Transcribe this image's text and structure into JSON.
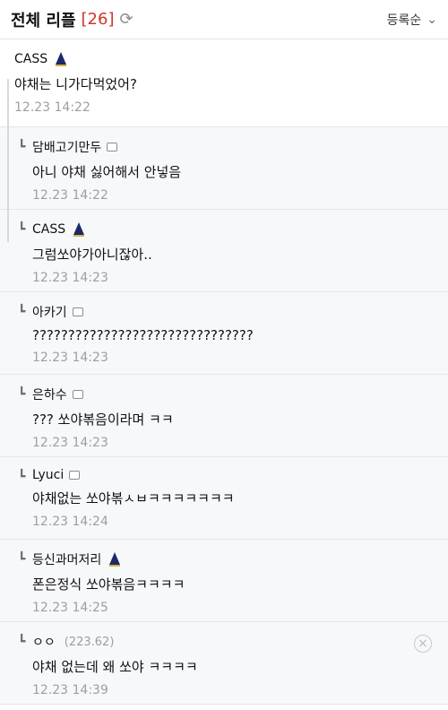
{
  "header": {
    "title": "전체 리플",
    "count": "[26]",
    "sort_label": "등록순"
  },
  "comments": [
    {
      "name": "CASS",
      "text": "야채는 니가다먹었어?",
      "time": "12.23 14:22"
    },
    {
      "name": "담배고기만두",
      "text": "아니 야채 싫어해서 안넣음",
      "time": "12.23 14:22"
    },
    {
      "name": "CASS",
      "text": "그럼쏘야가아니잖아..",
      "time": "12.23 14:23"
    },
    {
      "name": "아카기",
      "text": "???????????????????????????????",
      "time": "12.23 14:23"
    },
    {
      "name": "은하수",
      "text": "??? 쏘야볶음이라며 ㅋㅋ",
      "time": "12.23 14:23"
    },
    {
      "name": "Lyuci",
      "text": "야채없는 쏘야볶ㅅㅂㅋㅋㅋㅋㅋㅋㅋ",
      "time": "12.23 14:24"
    },
    {
      "name": "등신과머저리",
      "text": "폰은정식 쏘야볶음ㅋㅋㅋㅋ",
      "time": "12.23 14:25"
    },
    {
      "name": "ㅇㅇ",
      "ip": "(223.62)",
      "text": "야채 없는데 왜 쏘야 ㅋㅋㅋㅋ",
      "time": "12.23 14:39"
    }
  ],
  "icons": {
    "reply": "reply-arrow-icon",
    "level": "level-tree-icon",
    "square": "user-square-icon",
    "refresh": "refresh-icon",
    "close": "close-icon"
  },
  "colors": {
    "count": "#d0342c",
    "reply_bg": "#f7f8fa",
    "muted": "#9b9fa4"
  }
}
